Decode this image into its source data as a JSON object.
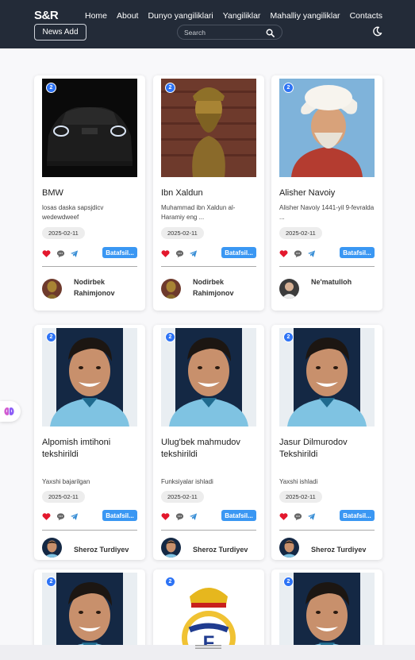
{
  "navbar": {
    "brand": "S&R",
    "links": [
      "Home",
      "About",
      "Dunyo yangiliklari",
      "Yangiliklar",
      "Mahalliy yangiliklar",
      "Contacts"
    ],
    "news_add": "News Add",
    "search_placeholder": "Search",
    "icons": {
      "search": "search-icon",
      "theme": "moon-icon"
    }
  },
  "colors": {
    "navbar": "#232b38",
    "badge": "#2d73f5",
    "button": "#3a97f3",
    "like": "#e3182d"
  },
  "action_icons": [
    "heart-icon",
    "comment-icon",
    "share-icon"
  ],
  "cards": [
    {
      "badge": "2",
      "title": "BMW",
      "desc": "losas daska sapsjdicv wedewdweef",
      "date": "2025-02-11",
      "more": "Batafsil...",
      "author": "Nodirbek Rahimjonov",
      "image": "car"
    },
    {
      "badge": "2",
      "title": "Ibn Xaldun",
      "desc": "Muhammad ibn Xaldun al-Haramiy eng ...",
      "date": "2025-02-11",
      "more": "Batafsil...",
      "author": "Nodirbek Rahimjonov",
      "image": "bust"
    },
    {
      "badge": "2",
      "title": "Alisher Navoiy",
      "desc": "Alisher Navoiy 1441-yil 9-fevralda ...",
      "date": "2025-02-11",
      "more": "Batafsil...",
      "author": "Ne'matulloh",
      "image": "poet"
    },
    {
      "badge": "2",
      "title": "Alpomish imtihoni tekshirildi",
      "desc": "Yaxshi bajarilgan",
      "date": "2025-02-11",
      "more": "Batafsil...",
      "author": "Sheroz Turdiyev",
      "image": "player"
    },
    {
      "badge": "2",
      "title": "Ulug'bek mahmudov tekshirildi",
      "desc": "Funksiyalar ishladi",
      "date": "2025-02-11",
      "more": "Batafsil...",
      "author": "Sheroz Turdiyev",
      "image": "player"
    },
    {
      "badge": "2",
      "title": "Jasur Dilmurodov Tekshirildi",
      "desc": "Yaxshi ishladi",
      "date": "2025-02-11",
      "more": "Batafsil...",
      "author": "Sheroz Turdiyev",
      "image": "player"
    },
    {
      "badge": "2",
      "image": "player"
    },
    {
      "badge": "2",
      "image": "crest"
    },
    {
      "badge": "2",
      "image": "player"
    }
  ]
}
